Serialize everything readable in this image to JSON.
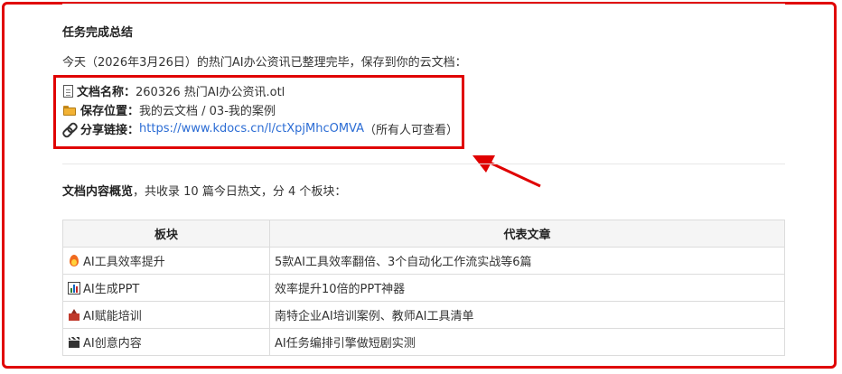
{
  "summary": {
    "section_title": "任务完成总结",
    "intro": "今天（2026年3月26日）的热门AI办公资讯已整理完毕，保存到你的云文档："
  },
  "doc_info": {
    "name_label": "文档名称：",
    "name_value": "260326 热门AI办公资讯.otl",
    "location_label": "保存位置：",
    "location_value": "我的云文档 / 03-我的案例",
    "share_label": "分享链接：",
    "share_url": "https://www.kdocs.cn/l/ctXpjMhcOMVA",
    "share_note": "（所有人可查看）"
  },
  "overview": {
    "label": "文档内容概览",
    "text": "，共收录 10 篇今日热文，分 4 个板块："
  },
  "table": {
    "headers": [
      "板块",
      "代表文章"
    ],
    "rows": [
      {
        "icon": "fire-icon",
        "block": "AI工具效率提升",
        "article": "5款AI工具效率翻倍、3个自动化工作流实战等6篇"
      },
      {
        "icon": "bar-chart-icon",
        "block": "AI生成PPT",
        "article": "效率提升10倍的PPT神器"
      },
      {
        "icon": "school-icon",
        "block": "AI赋能培训",
        "article": "南特企业AI培训案例、教师AI工具清单"
      },
      {
        "icon": "clapper-icon",
        "block": "AI创意内容",
        "article": "AI任务编排引擎做短剧实测"
      }
    ]
  },
  "colors": {
    "highlight": "#e00000",
    "link": "#2b6cd4"
  }
}
